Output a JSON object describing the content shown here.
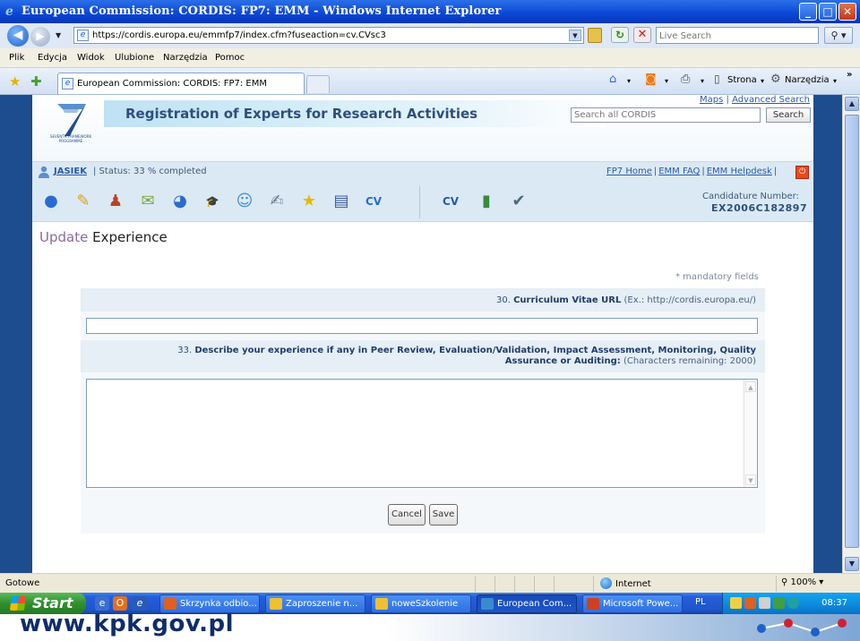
{
  "window": {
    "title": "European Commission: CORDIS: FP7: EMM - Windows Internet Explorer",
    "controls": {
      "minimize": "_",
      "maximize": "□",
      "close": "✕"
    }
  },
  "address_bar": {
    "url": "https://cordis.europa.eu/emmfp7/index.cfm?fuseaction=cv.CVsc3",
    "live_search_placeholder": "Live Search"
  },
  "menu": [
    "Plik",
    "Edycja",
    "Widok",
    "Ulubione",
    "Narzędzia",
    "Pomoc"
  ],
  "tabbar": {
    "tab_label": "European Commission: CORDIS: FP7: EMM",
    "strona": "Strona",
    "narzedzia": "Narzędzia",
    "overflow": "»"
  },
  "header": {
    "fp7_caption": "SEVENTH FRAMEWORK PROGRAMME",
    "title": "Registration of Experts for Research Activities",
    "links": {
      "maps": "Maps",
      "sep": "|",
      "advanced": "Advanced Search"
    },
    "search_placeholder": "Search all CORDIS",
    "search_button": "Search"
  },
  "userbar": {
    "user": "JASIEK",
    "status": "| Status: 33 % completed",
    "links": [
      "FP7 Home",
      "EMM FAQ",
      "EMM Helpdesk"
    ],
    "sep": "|"
  },
  "toolbar": {
    "icons": [
      {
        "name": "personal-data-icon",
        "glyph": "●",
        "color": "#2a6bd0"
      },
      {
        "name": "contact-details-icon",
        "glyph": "✎",
        "color": "#e0a020"
      },
      {
        "name": "family-icon",
        "glyph": "♟",
        "color": "#c04020"
      },
      {
        "name": "languages-icon",
        "glyph": "✉",
        "color": "#7aaa3a"
      },
      {
        "name": "expertise-icon",
        "glyph": "◕",
        "color": "#2a6bd0"
      },
      {
        "name": "education-icon",
        "glyph": "🎓",
        "color": "#1f3e6b"
      },
      {
        "name": "professional-icon",
        "glyph": "☺",
        "color": "#3a8ad0"
      },
      {
        "name": "experience-icon",
        "glyph": "✍",
        "color": "#6a7a8a"
      },
      {
        "name": "favourites-icon",
        "glyph": "★",
        "color": "#e8b800"
      },
      {
        "name": "documents-icon",
        "glyph": "▤",
        "color": "#3a5aa0"
      },
      {
        "name": "cv-export-icon",
        "glyph": "CV",
        "color": "#2a6bd0"
      }
    ],
    "tools": [
      {
        "name": "cv-view-icon",
        "glyph": "CV",
        "color": "#2a5aa8"
      },
      {
        "name": "book-icon",
        "glyph": "▮",
        "color": "#3a8a3a"
      },
      {
        "name": "checklist-icon",
        "glyph": "✔",
        "color": "#4a6a7a"
      }
    ],
    "candidature_label": "Candidature Number:",
    "candidature_number": "EX2006C182897"
  },
  "page": {
    "heading_prefix": "Update",
    "heading_rest": " Experience",
    "mandatory": "* mandatory fields",
    "q30": {
      "number": "30.",
      "label": "Curriculum Vitae URL",
      "hint": "(Ex.: http://cordis.europa.eu/)",
      "value": ""
    },
    "q33": {
      "number": "33.",
      "label_line1": "Describe your experience if any in Peer Review, Evaluation/Validation, Impact Assessment, Monitoring, Quality",
      "label_line2": "Assurance or Auditing:",
      "hint": "(Characters remaining: 2000)",
      "value": ""
    },
    "cancel": "Cancel",
    "save": "Save"
  },
  "statusbar": {
    "left": "Gotowe",
    "zone": "Internet",
    "zoom": "100%"
  },
  "taskbar": {
    "start": "Start",
    "tasks": [
      {
        "label": "Skrzynka odbio...",
        "color": "#e06020",
        "active": false
      },
      {
        "label": "Zaproszenie n...",
        "color": "#f0c030",
        "active": false
      },
      {
        "label": "noweSzkolenie",
        "color": "#f0c030",
        "active": false
      },
      {
        "label": "European Com...",
        "color": "#3a8ad0",
        "active": true
      },
      {
        "label": "Microsoft Powe...",
        "color": "#d04020",
        "active": false
      }
    ],
    "lang": "PL",
    "clock": "08:37"
  },
  "slide_footer": "www.kpk.gov.pl"
}
